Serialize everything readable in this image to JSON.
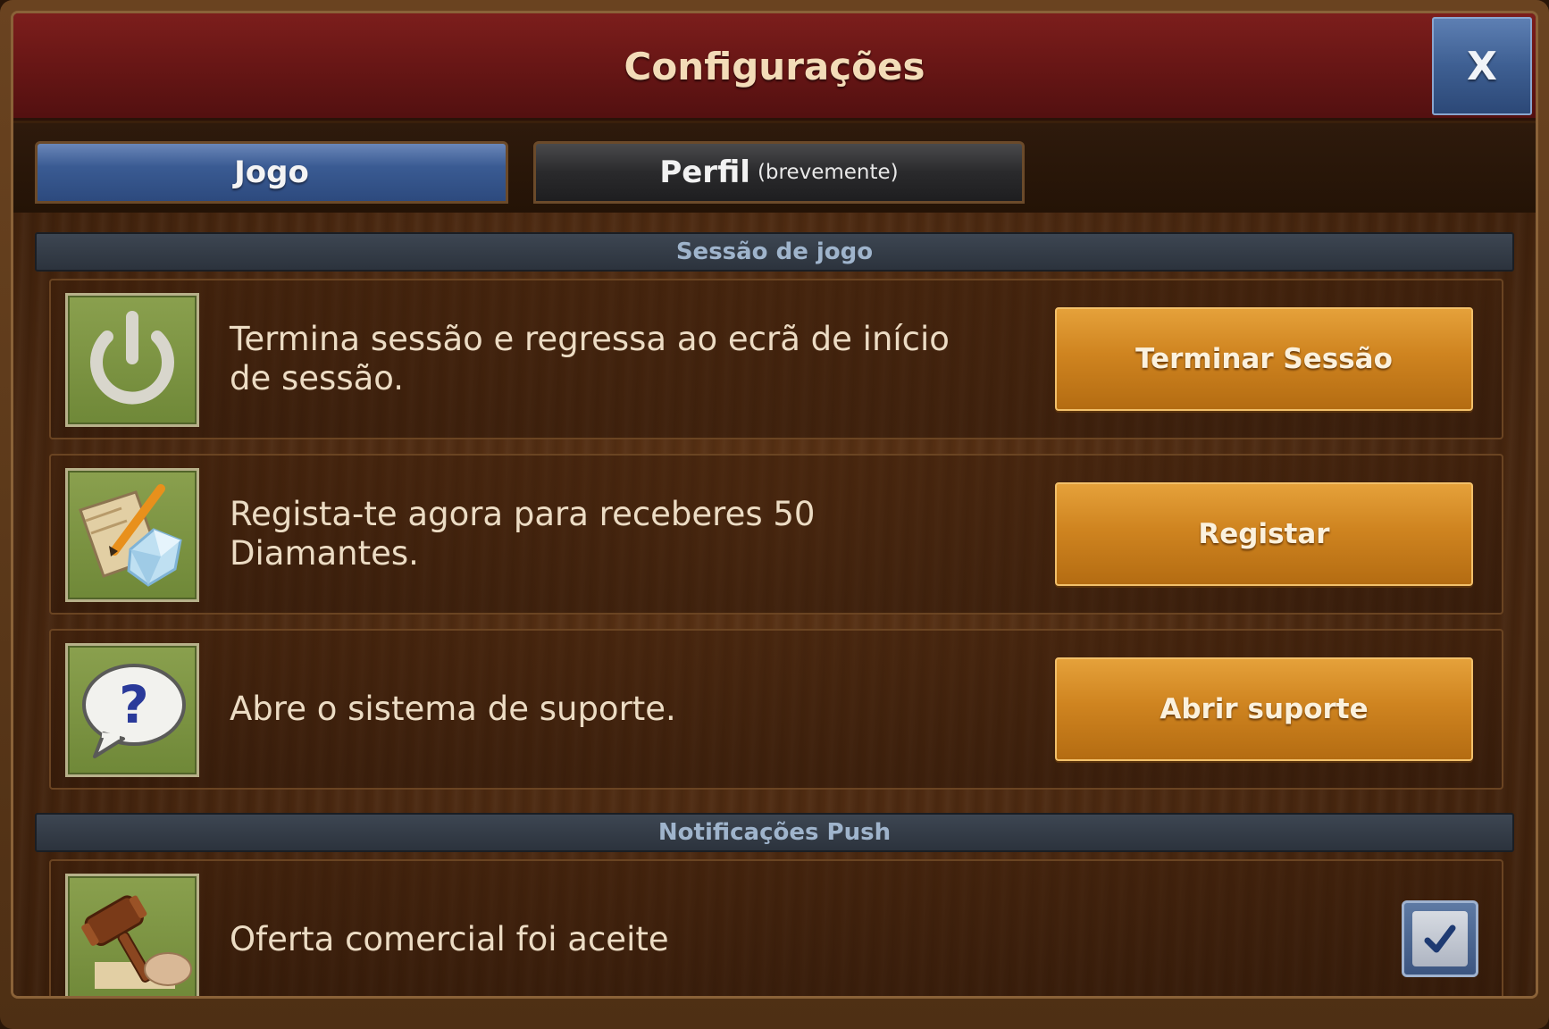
{
  "dialog": {
    "title": "Configurações",
    "close_label": "X"
  },
  "tabs": [
    {
      "label": "Jogo",
      "sub": "",
      "active": true
    },
    {
      "label": "Perfil",
      "sub": "(brevemente)",
      "active": false
    }
  ],
  "sections": {
    "session": {
      "header": "Sessão de jogo",
      "rows": [
        {
          "icon": "power-icon",
          "text": "Termina sessão e regressa ao ecrã de início de sessão.",
          "button": "Terminar Sessão"
        },
        {
          "icon": "register-diamonds-icon",
          "text": "Regista-te agora para receberes 50 Diamantes.",
          "button": "Registar"
        },
        {
          "icon": "support-question-icon",
          "text": "Abre o sistema de suporte.",
          "button": "Abrir suporte"
        }
      ]
    },
    "push": {
      "header": "Notificações Push",
      "rows": [
        {
          "icon": "gavel-icon",
          "text": "Oferta comercial foi aceite",
          "checked": true
        }
      ]
    }
  },
  "colors": {
    "title_bar": "#6a1716",
    "close_button": "#3e5f92",
    "active_tab": "#3a5b93",
    "inactive_tab": "#2a2a2c",
    "action_button": "#cf8420",
    "section_header": "#2c333d",
    "icon_background": "#7a9440"
  }
}
